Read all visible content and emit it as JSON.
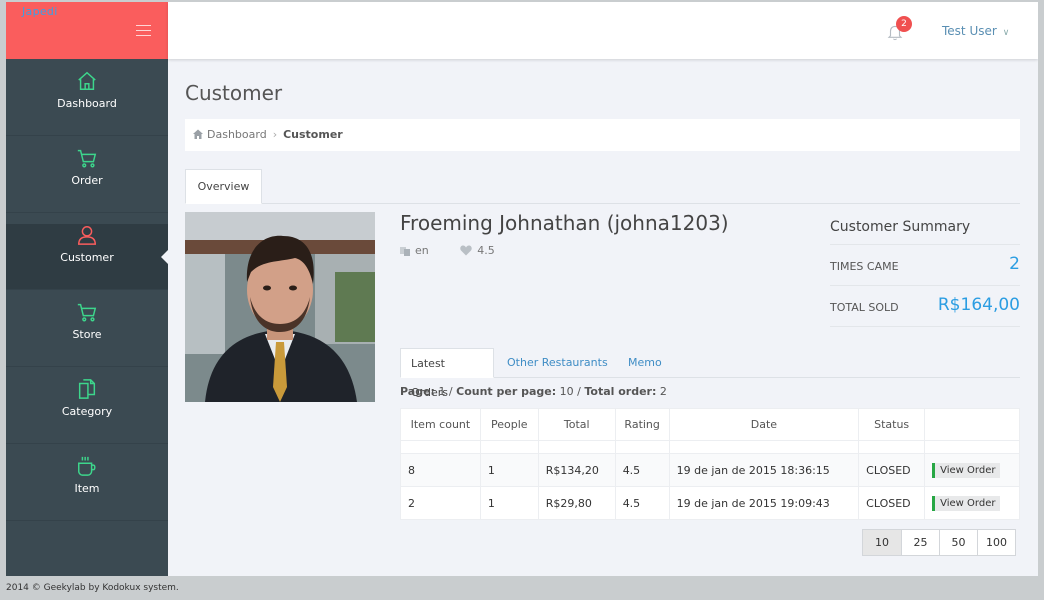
{
  "app": {
    "logo": "Japedi"
  },
  "sidebar": {
    "items": [
      {
        "label": "Dashboard",
        "icon": "home-icon"
      },
      {
        "label": "Order",
        "icon": "cart-icon"
      },
      {
        "label": "Customer",
        "icon": "user-icon",
        "active": true
      },
      {
        "label": "Store",
        "icon": "cart-icon"
      },
      {
        "label": "Category",
        "icon": "copy-icon"
      },
      {
        "label": "Item",
        "icon": "cup-icon"
      }
    ],
    "icon_color": "#3dd68c",
    "active_icon_color": "#fa5d5d"
  },
  "topbar": {
    "notifications": "2",
    "user": "Test User"
  },
  "page": {
    "title": "Customer",
    "breadcrumb": {
      "home": "Dashboard",
      "current": "Customer"
    },
    "tab": "Overview"
  },
  "customer": {
    "name": "Froeming Johnathan (johna1203)",
    "lang": "en",
    "rating": "4.5"
  },
  "summary": {
    "title": "Customer Summary",
    "times_came_label": "TIMES CAME",
    "times_came": "2",
    "total_sold_label": "TOTAL SOLD",
    "total_sold": "R$164,00"
  },
  "subtabs": [
    "Latest Orders",
    "Other Restaurants",
    "Memo"
  ],
  "pageinfo": {
    "page_label": "Page:",
    "page": "1",
    "count_label": "Count per page:",
    "count": "10",
    "total_label": "Total order:",
    "total": "2"
  },
  "orders": {
    "headers": [
      "Item count",
      "People",
      "Total",
      "Rating",
      "Date",
      "Status",
      ""
    ],
    "rows": [
      [
        "8",
        "1",
        "R$134,20",
        "4.5",
        "19 de jan de 2015 18:36:15",
        "CLOSED",
        "View Order"
      ],
      [
        "2",
        "1",
        "R$29,80",
        "4.5",
        "19 de jan de 2015 19:09:43",
        "CLOSED",
        "View Order"
      ]
    ]
  },
  "pager": [
    "10",
    "25",
    "50",
    "100"
  ],
  "footer": "2014 © Geekylab by Kodokux system."
}
